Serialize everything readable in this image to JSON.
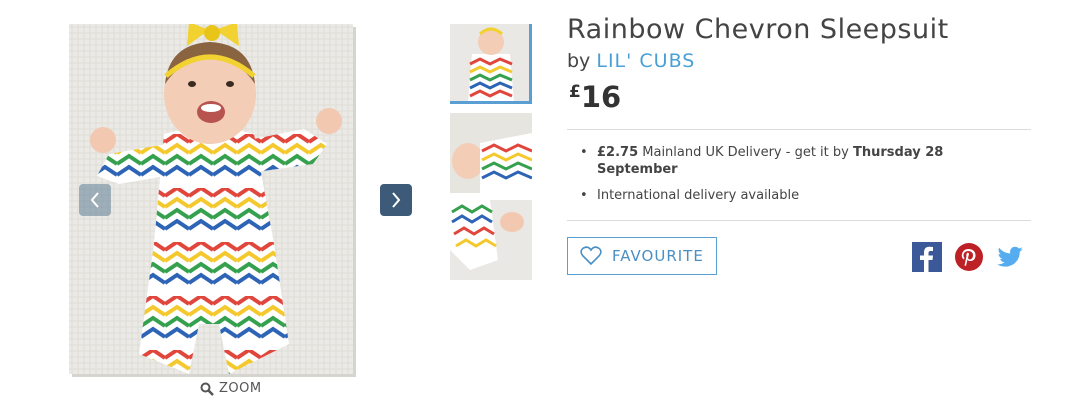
{
  "gallery": {
    "main_image_alt": "Baby wearing rainbow chevron sleepsuit",
    "prev_icon": "chevron-left-icon",
    "next_icon": "chevron-right-icon",
    "zoom_label": "ZOOM",
    "zoom_icon": "search-icon",
    "thumbnails": [
      {
        "alt": "thumbnail 1",
        "active": true
      },
      {
        "alt": "thumbnail 2",
        "active": false
      },
      {
        "alt": "thumbnail 3",
        "active": false
      }
    ],
    "colors": {
      "accent": "#5a9fd4",
      "nav_active": "#3d5a78"
    }
  },
  "product": {
    "title": "Rainbow Chevron Sleepsuit",
    "by_prefix": "by",
    "brand": "LIL' CUBS",
    "price_currency": "£",
    "price_amount": "16"
  },
  "delivery": {
    "item1_price": "£2.75",
    "item1_text": " Mainland UK Delivery - get it by ",
    "item1_date": "Thursday 28 September",
    "item2_text": "International delivery available"
  },
  "actions": {
    "favourite_label": "FAVOURITE",
    "favourite_icon": "heart-icon",
    "share": [
      {
        "name": "facebook-icon",
        "color": "#3b5998"
      },
      {
        "name": "pinterest-icon",
        "color": "#bd2126"
      },
      {
        "name": "twitter-icon",
        "color": "#55acee"
      }
    ]
  }
}
